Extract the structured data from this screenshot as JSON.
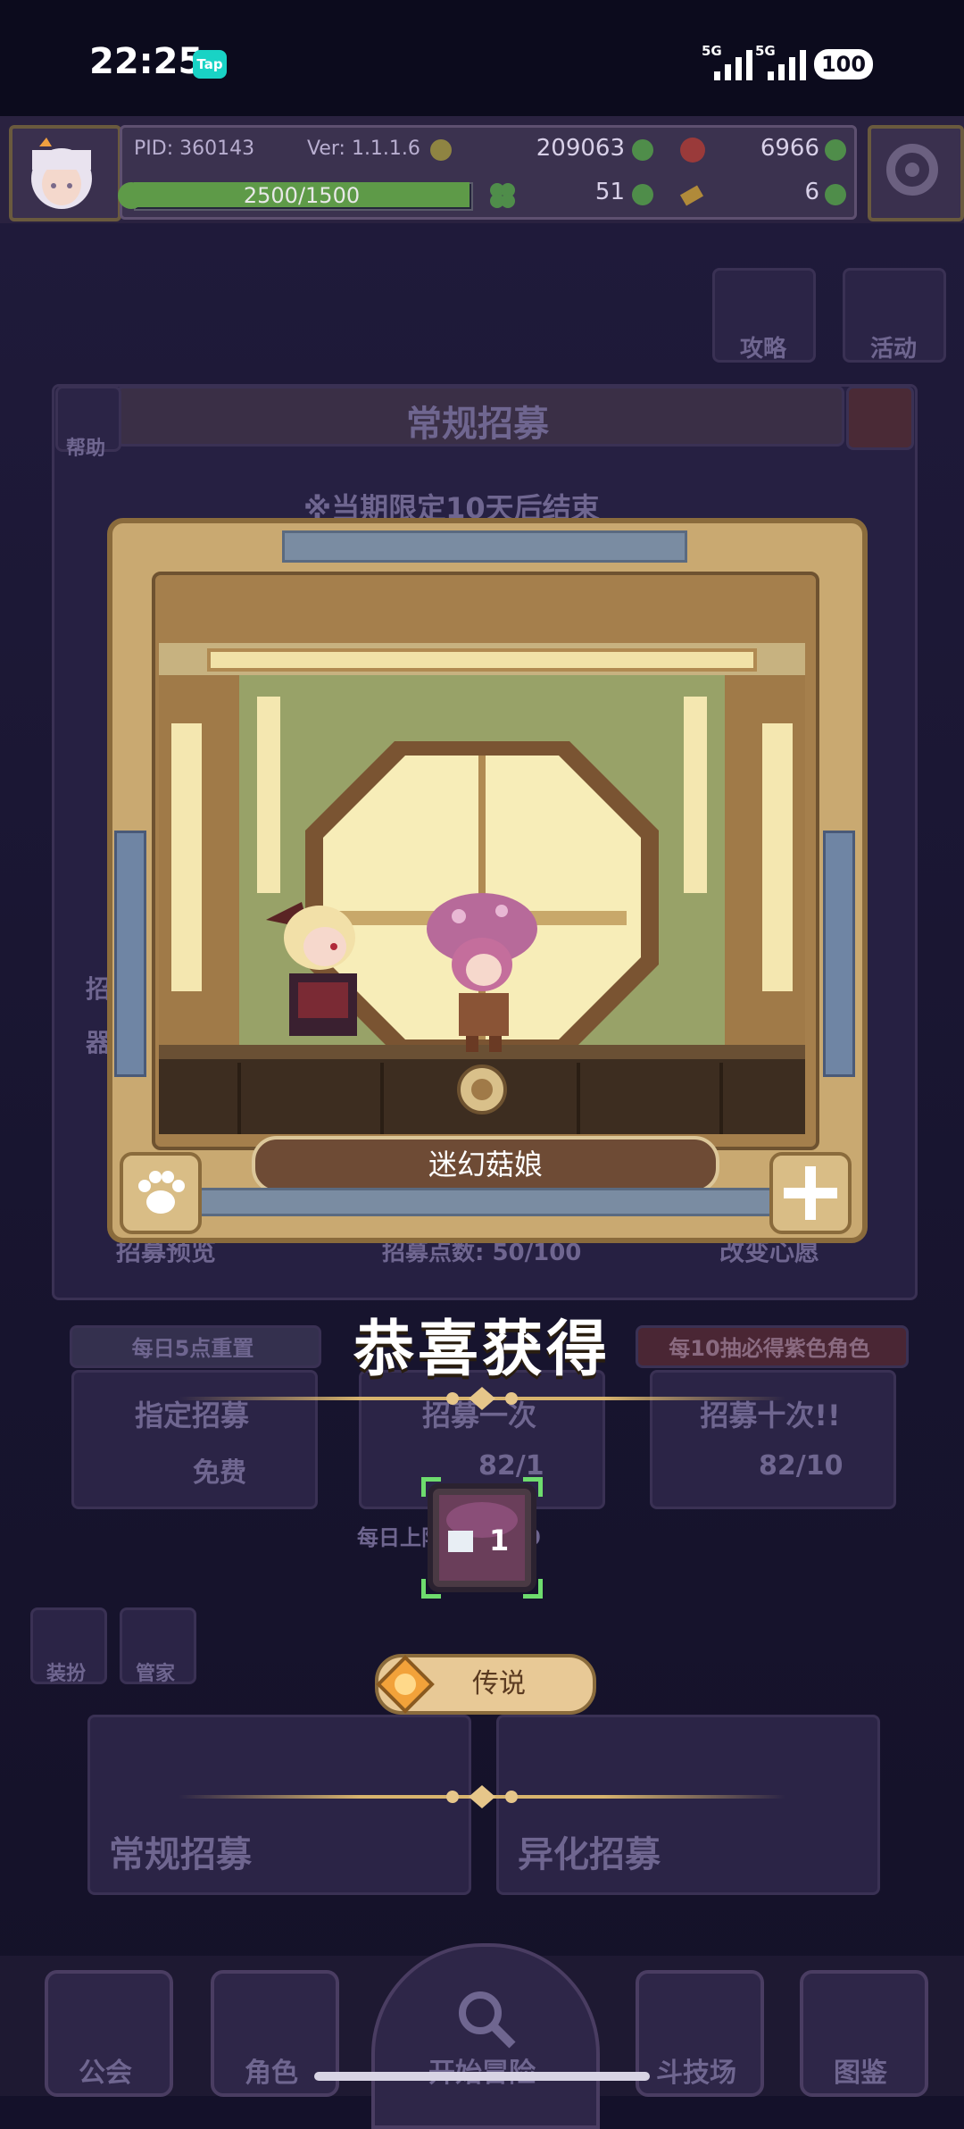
{
  "status_bar": {
    "time": "22:25",
    "app_badge": "Tap",
    "signal_1_label": "5G",
    "signal_2_label": "5G",
    "battery": "100"
  },
  "hud": {
    "pid": "PID: 360143",
    "version": "Ver: 1.1.1.6",
    "gold": "209063",
    "gems": "6966",
    "clover": "51",
    "tickets": "6",
    "stamina": "2500/1500",
    "stamina_fraction": 1.0
  },
  "background": {
    "guide_label": "攻略",
    "event_label": "活动",
    "help_label": "帮助",
    "panel_title": "常规招募",
    "limited_notice": "※当期限定10天后结束",
    "side_label_1": "招",
    "side_label_2": "器",
    "preview_label": "招募预览",
    "points_label": "招募点数: 50/100",
    "wish_label": "改变心愿",
    "daily_reset": "每日5点重置",
    "guarantee": "每10抽必得紫色角色",
    "designated_label": "指定招募",
    "designated_cost": "免费",
    "single_label": "招募一次",
    "single_cost": "82/1",
    "ten_label": "招募十次!!",
    "ten_cost": "82/10",
    "daily_limit": "每日上限: 0/9999",
    "costume_label": "装扮",
    "manager_label": "管家",
    "tab_normal": "常规招募",
    "tab_alter": "异化招募"
  },
  "reward": {
    "character_name": "迷幻菇娘",
    "congrats": "恭喜获得",
    "item_count": "1",
    "rarity": "传说"
  },
  "bottom_nav": {
    "guild": "公会",
    "characters": "角色",
    "start": "开始冒险",
    "arena": "斗技场",
    "codex": "图鉴"
  }
}
